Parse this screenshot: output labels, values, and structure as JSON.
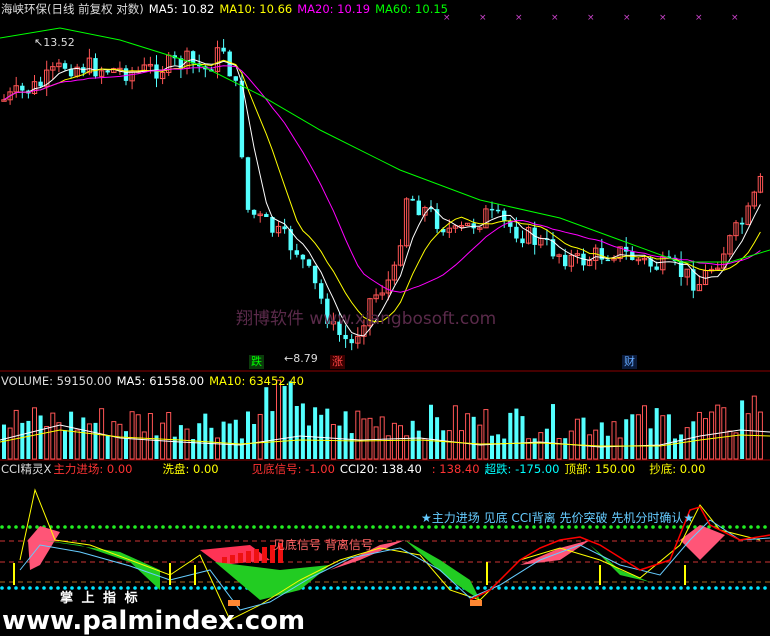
{
  "colors": {
    "up": "#ff5555",
    "down": "#54ffff",
    "ma5": "#ffffff",
    "ma10": "#ffff00",
    "ma20": "#ff00ff",
    "ma60": "#00ff00",
    "grid": "#8b0000"
  },
  "price_panel": {
    "title": "海峡环保(日线 前复权 对数)",
    "ma5": "MA5: 10.82",
    "ma10": "MA10: 10.66",
    "ma20": "MA20: 10.19",
    "ma60": "MA60: 10.15",
    "high_label": "13.52",
    "low_label": "8.79",
    "tag_fall": "跌",
    "tag_rise": "涨",
    "tag_cai": "财"
  },
  "volume_panel": {
    "volume": "VOLUME: 59150.00",
    "ma5": "MA5: 61558.00",
    "ma10": "MA10: 63452.40"
  },
  "indicator_panel": {
    "name": "CCI精灵X",
    "zhuli": "主力进场: 0.00",
    "xipan": "洗盘: 0.00",
    "jiandi": "见底信号: -1.00",
    "cci20": "CCI20: 138.40",
    "cci_val": ": 138.40",
    "chaodie": "超跌: -175.00",
    "dingbu": "顶部: 150.00",
    "chaodi": "抄底: 0.00",
    "legend": "★主力进场 见底 CCI背离 先价突破 先机分时确认★",
    "signal_text": "见底信号 背离信号",
    "watermark_label": "掌 上 指 标"
  },
  "watermarks": {
    "center": "翔博软件 www.xiangbosoft.com",
    "footer": "www.palmindex.com"
  }
}
